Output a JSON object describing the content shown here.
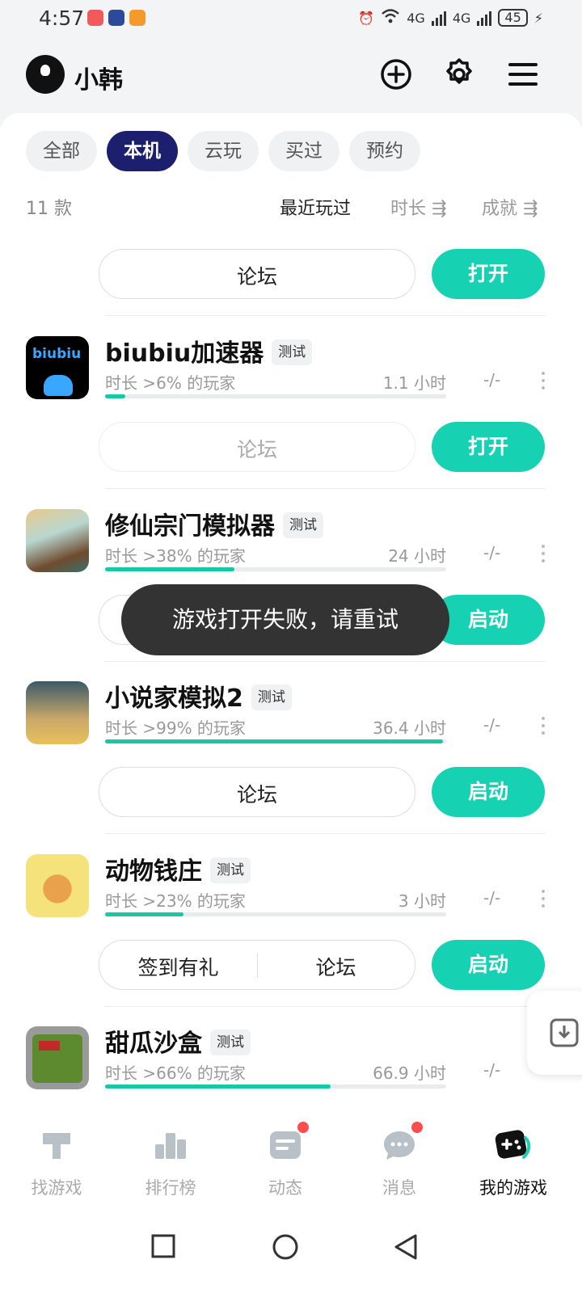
{
  "status": {
    "time": "4:57",
    "net1": "4G",
    "net2": "4G",
    "battery": "45"
  },
  "header": {
    "username": "小韩"
  },
  "tabs": [
    "全部",
    "本机",
    "云玩",
    "买过",
    "预约"
  ],
  "active_tab": "本机",
  "list": {
    "count": "11 款",
    "sort_recent": "最近玩过",
    "sort_duration": "时长 ⇶",
    "sort_achievement": "成就 ⇶"
  },
  "first_card": {
    "forum": "论坛",
    "action": "打开"
  },
  "games": [
    {
      "name": "biubiu加速器",
      "badge": "测试",
      "stat": "时长 >6% 的玩家",
      "hours": "1.1 小时",
      "achievement": "-/-",
      "progress": 0.06,
      "forum": "论坛",
      "action": "打开"
    },
    {
      "name": "修仙宗门模拟器",
      "badge": "测试",
      "stat": "时长 >38% 的玩家",
      "hours": "24 小时",
      "achievement": "-/-",
      "progress": 0.38,
      "action": "启动"
    },
    {
      "name": "小说家模拟2",
      "badge": "测试",
      "stat": "时长 >99% 的玩家",
      "hours": "36.4 小时",
      "achievement": "-/-",
      "progress": 0.99,
      "forum": "论坛",
      "action": "启动"
    },
    {
      "name": "动物钱庄",
      "badge": "测试",
      "stat": "时长 >23% 的玩家",
      "hours": "3 小时",
      "achievement": "-/-",
      "progress": 0.23,
      "checkin": "签到有礼",
      "forum": "论坛",
      "action": "启动"
    },
    {
      "name": "甜瓜沙盒",
      "badge": "测试",
      "stat": "时长 >66% 的玩家",
      "hours": "66.9 小时",
      "achievement": "-/-",
      "progress": 0.66
    }
  ],
  "app_icon_text": "biubiu",
  "toast": "游戏打开失败，请重试",
  "bottom_nav": [
    "找游戏",
    "排行榜",
    "动态",
    "消息",
    "我的游戏"
  ],
  "colors": {
    "accent": "#16d2b2",
    "active_tab": "#1c1f6d",
    "progress": "#16c8a6",
    "badge_dot": "#ff4d4f"
  }
}
